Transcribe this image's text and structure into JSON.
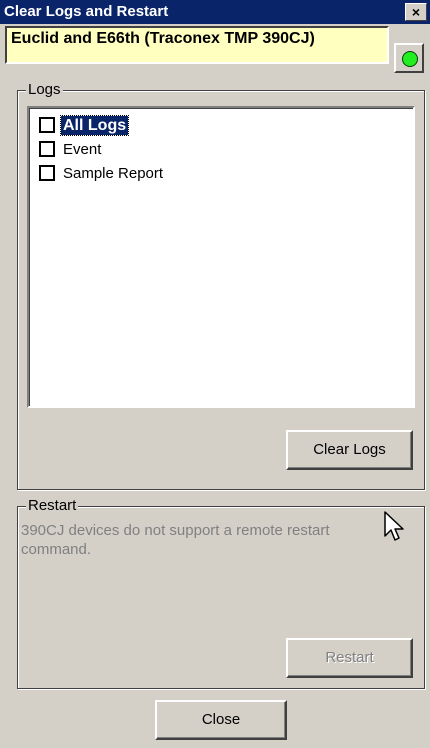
{
  "window": {
    "title": "Clear Logs and Restart",
    "close_glyph": "×"
  },
  "device": {
    "name": "Euclid and E66th (Traconex TMP 390CJ)",
    "status_color": "#22ee22"
  },
  "logs": {
    "group_label": "Logs",
    "items": [
      {
        "label": "All Logs",
        "checked": false,
        "selected": true
      },
      {
        "label": "Event",
        "checked": false,
        "selected": false
      },
      {
        "label": "Sample Report",
        "checked": false,
        "selected": false
      }
    ],
    "clear_button": "Clear Logs"
  },
  "restart": {
    "group_label": "Restart",
    "message": "390CJ devices do not support a remote restart command.",
    "restart_button": "Restart"
  },
  "footer": {
    "close_button": "Close"
  }
}
